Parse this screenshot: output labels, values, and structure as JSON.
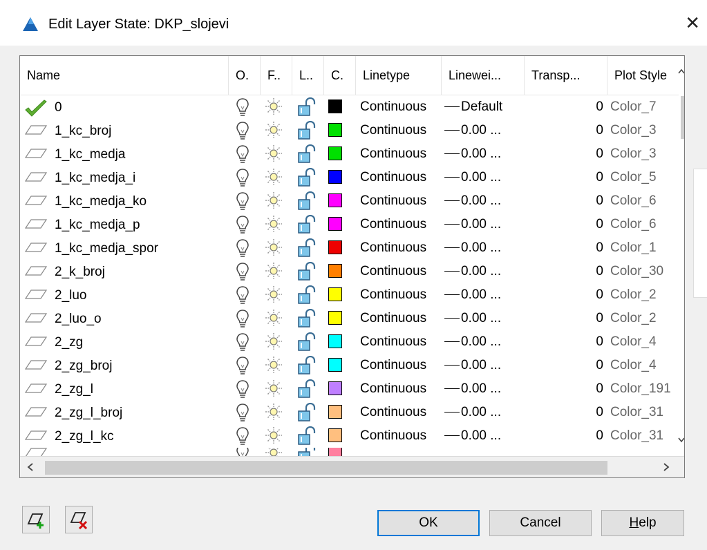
{
  "window": {
    "title": "Edit Layer State: DKP_slojevi",
    "close_glyph": "✕"
  },
  "columns": [
    "Name",
    "O.",
    "F..",
    "L..",
    "C.",
    "Linetype",
    "Linewei...",
    "Transp...",
    "Plot Style"
  ],
  "rows": [
    {
      "name": "0",
      "current": true,
      "color": "#000000",
      "linetype": "Continuous",
      "lineweight": "Default",
      "transparency": "0",
      "plot_style": "Color_7"
    },
    {
      "name": "1_kc_broj",
      "color": "#00e000",
      "linetype": "Continuous",
      "lineweight": "0.00 ...",
      "transparency": "0",
      "plot_style": "Color_3"
    },
    {
      "name": "1_kc_medja",
      "color": "#00e000",
      "linetype": "Continuous",
      "lineweight": "0.00 ...",
      "transparency": "0",
      "plot_style": "Color_3"
    },
    {
      "name": "1_kc_medja_i",
      "color": "#0000ff",
      "linetype": "Continuous",
      "lineweight": "0.00 ...",
      "transparency": "0",
      "plot_style": "Color_5"
    },
    {
      "name": "1_kc_medja_ko",
      "color": "#ff00ff",
      "linetype": "Continuous",
      "lineweight": "0.00 ...",
      "transparency": "0",
      "plot_style": "Color_6"
    },
    {
      "name": "1_kc_medja_p",
      "color": "#ff00ff",
      "linetype": "Continuous",
      "lineweight": "0.00 ...",
      "transparency": "0",
      "plot_style": "Color_6"
    },
    {
      "name": "1_kc_medja_spor",
      "color": "#ee0000",
      "linetype": "Continuous",
      "lineweight": "0.00 ...",
      "transparency": "0",
      "plot_style": "Color_1"
    },
    {
      "name": "2_k_broj",
      "color": "#ff7f00",
      "linetype": "Continuous",
      "lineweight": "0.00 ...",
      "transparency": "0",
      "plot_style": "Color_30"
    },
    {
      "name": "2_luo",
      "color": "#ffff00",
      "linetype": "Continuous",
      "lineweight": "0.00 ...",
      "transparency": "0",
      "plot_style": "Color_2"
    },
    {
      "name": "2_luo_o",
      "color": "#ffff00",
      "linetype": "Continuous",
      "lineweight": "0.00 ...",
      "transparency": "0",
      "plot_style": "Color_2"
    },
    {
      "name": "2_zg",
      "color": "#00ffff",
      "linetype": "Continuous",
      "lineweight": "0.00 ...",
      "transparency": "0",
      "plot_style": "Color_4"
    },
    {
      "name": "2_zg_broj",
      "color": "#00ffff",
      "linetype": "Continuous",
      "lineweight": "0.00 ...",
      "transparency": "0",
      "plot_style": "Color_4"
    },
    {
      "name": "2_zg_l",
      "color": "#bf7fff",
      "linetype": "Continuous",
      "lineweight": "0.00 ...",
      "transparency": "0",
      "plot_style": "Color_191"
    },
    {
      "name": "2_zg_l_broj",
      "color": "#ffbf7f",
      "linetype": "Continuous",
      "lineweight": "0.00 ...",
      "transparency": "0",
      "plot_style": "Color_31"
    },
    {
      "name": "2_zg_l_kc",
      "color": "#ffbf7f",
      "linetype": "Continuous",
      "lineweight": "0.00 ...",
      "transparency": "0",
      "plot_style": "Color_31"
    }
  ],
  "partial_row_color": "#ff7f9f",
  "buttons": {
    "ok": "OK",
    "cancel": "Cancel",
    "help_hotkey": "H",
    "help_rest": "elp"
  },
  "icons": {
    "on": "lightbulb-icon",
    "freeze": "sun-icon",
    "lock": "unlock-icon",
    "add_layers": "add-layers-icon",
    "remove_layers": "remove-layers-icon"
  }
}
